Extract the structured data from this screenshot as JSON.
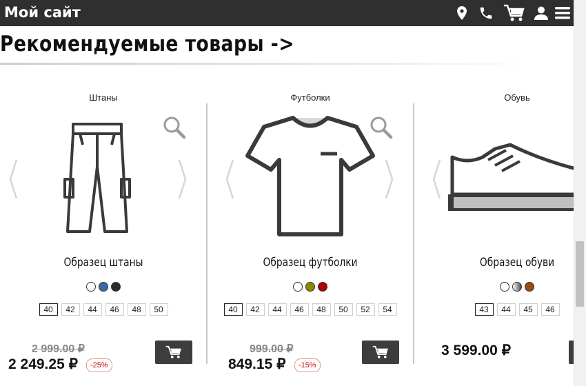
{
  "header": {
    "site_title": "Мой сайт",
    "icons": [
      "location-icon",
      "phone-icon",
      "cart-icon",
      "user-icon",
      "menu-icon"
    ]
  },
  "section": {
    "title": "Рекомендуемые товары ->"
  },
  "products": [
    {
      "category": "Штаны",
      "name": "Образец штаны",
      "colors": [
        "#ffffff",
        "#3a6aa8",
        "#2b2b2b"
      ],
      "sizes": [
        "40",
        "42",
        "44",
        "46",
        "48",
        "50"
      ],
      "selected_size": "40",
      "old_price": "2 999.00 ₽",
      "price": "2 249.25 ₽",
      "discount": "-25%"
    },
    {
      "category": "Футболки",
      "name": "Образец футболки",
      "colors": [
        "#ffffff",
        "#8a8a00",
        "#b00000"
      ],
      "sizes": [
        "40",
        "42",
        "44",
        "46",
        "48",
        "50",
        "52",
        "54"
      ],
      "selected_size": "40",
      "old_price": "999.00 ₽",
      "price": "849.15 ₽",
      "discount": "-15%"
    },
    {
      "category": "Обувь",
      "name": "Образец обуви",
      "colors": [
        "#ffffff",
        "#7a7a7a",
        "#9a4a10"
      ],
      "sizes": [
        "43",
        "44",
        "45",
        "46"
      ],
      "selected_size": "43",
      "price": "3 599.00 ₽"
    }
  ]
}
